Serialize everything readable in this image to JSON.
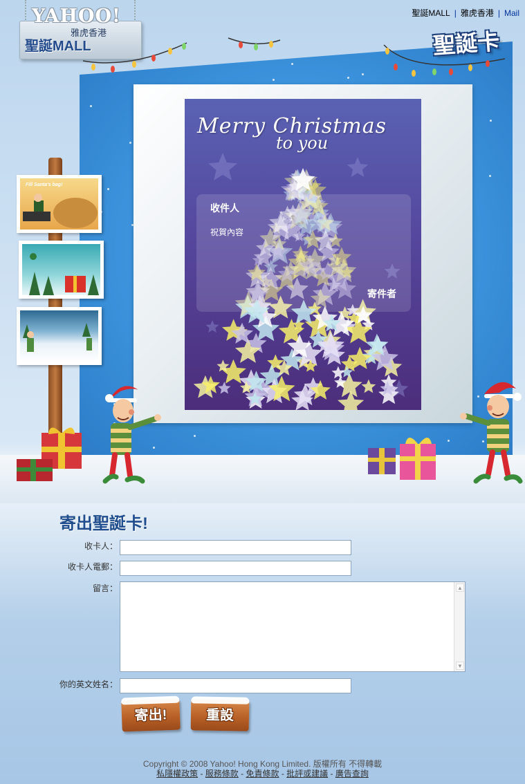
{
  "top_links": [
    {
      "label": "聖誕MALL"
    },
    {
      "label": "雅虎香港"
    },
    {
      "label": "Mail"
    }
  ],
  "logo": {
    "main": "YAHOO!",
    "sub": "雅虎香港",
    "mall": "聖誕MALL"
  },
  "page_title": "聖誕卡",
  "card": {
    "title_line1": "Merry Christmas",
    "title_line2": "to you",
    "recipient_label": "收件人",
    "greeting_label": "祝賀內容",
    "sender_label": "寄件者"
  },
  "thumbnails": [
    {
      "caption": "Fill Santa's bag!"
    },
    {
      "caption": ""
    },
    {
      "caption": ""
    }
  ],
  "form": {
    "title": "寄出聖誕卡!",
    "recipient_label": "收卡人：",
    "recipient_value": "",
    "recipient_email_label": "收卡人電郵：",
    "recipient_email_value": "",
    "message_label": "留言：",
    "message_value": "",
    "sender_name_label": "你的英文姓名：",
    "sender_name_value": "",
    "send_button": "寄出!",
    "reset_button": "重設"
  },
  "footer": {
    "copyright": "Copyright © 2008 Yahoo! Hong Kong Limited. 版權所有 不得轉載",
    "links": [
      {
        "label": "私隱權政策"
      },
      {
        "label": "服務條款"
      },
      {
        "label": "免責條款"
      },
      {
        "label": "批評或建議"
      },
      {
        "label": "廣告查詢"
      }
    ],
    "separator": " - "
  },
  "colors": {
    "board_blue": "#3d94dd",
    "card_purple": "#55479d",
    "title_blue": "#1f4d8d",
    "button_wood": "#b65e25"
  }
}
